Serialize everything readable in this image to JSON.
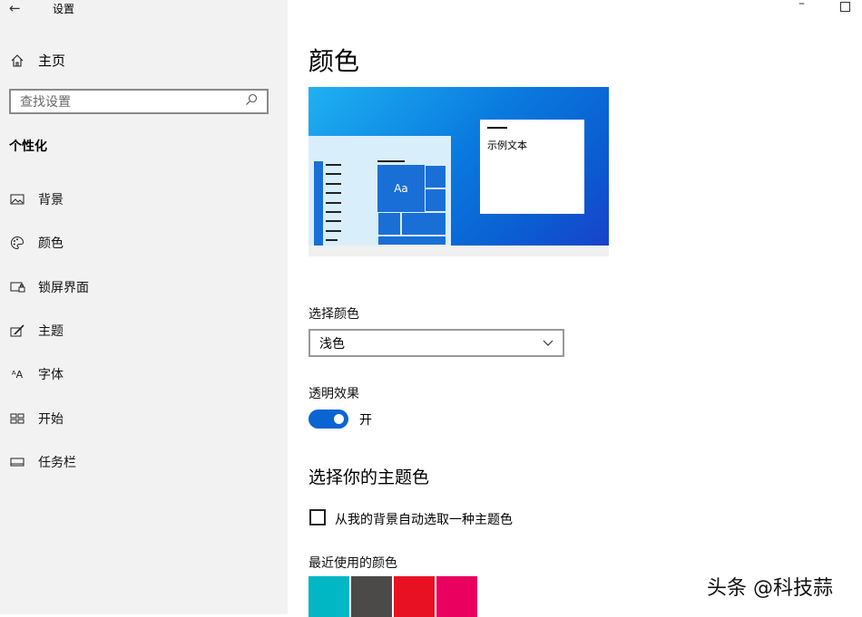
{
  "titlebar": {
    "back_icon": "back-arrow-icon",
    "title": "设置",
    "minimize": "–"
  },
  "sidebar": {
    "home_label": "主页",
    "search_placeholder": "查找设置",
    "section": "个性化",
    "items": [
      {
        "label": "背景",
        "icon": "picture-icon"
      },
      {
        "label": "颜色",
        "icon": "palette-icon"
      },
      {
        "label": "锁屏界面",
        "icon": "lock-screen-icon"
      },
      {
        "label": "主题",
        "icon": "theme-brush-icon"
      },
      {
        "label": "字体",
        "icon": "font-icon"
      },
      {
        "label": "开始",
        "icon": "start-icon"
      },
      {
        "label": "任务栏",
        "icon": "taskbar-icon"
      }
    ]
  },
  "main": {
    "title": "颜色",
    "preview": {
      "tile_text": "Aa",
      "sample_text": "示例文本"
    },
    "choose_color_label": "选择颜色",
    "choose_color_value": "浅色",
    "transparency_label": "透明效果",
    "transparency_state": "开",
    "accent_heading": "选择你的主题色",
    "auto_accent_label": "从我的背景自动选取一种主题色",
    "recent_colors_label": "最近使用的颜色",
    "recent_colors": [
      "#00b7c3",
      "#4c4a48",
      "#e81123",
      "#ea005e"
    ]
  },
  "watermark": "头条 @科技蒜",
  "colors": {
    "accent": "#0a64d2",
    "sidebar_bg": "#f2f2f2"
  }
}
